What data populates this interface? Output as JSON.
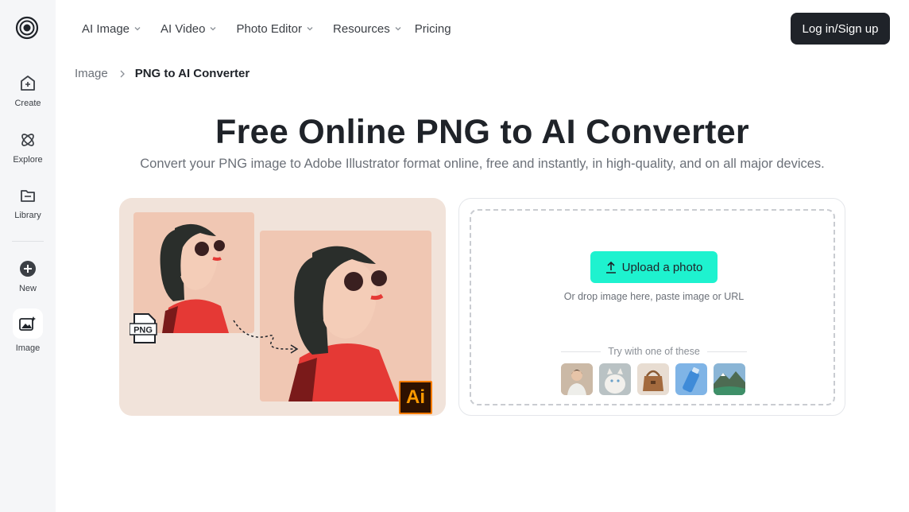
{
  "nav": {
    "items": [
      {
        "label": "AI Image"
      },
      {
        "label": "AI Video"
      },
      {
        "label": "Photo Editor"
      },
      {
        "label": "Resources"
      }
    ],
    "pricing": "Pricing",
    "login": "Log in/Sign up"
  },
  "sidebar": {
    "create": "Create",
    "explore": "Explore",
    "library": "Library",
    "new": "New",
    "image": "Image"
  },
  "breadcrumb": {
    "parent": "Image",
    "current": "PNG to AI Converter"
  },
  "hero": {
    "title": "Free Online PNG to AI Converter",
    "subtitle": "Convert your PNG image to Adobe Illustrator format online, free and instantly, in high-quality, and on all major devices."
  },
  "illustration": {
    "png_badge": "PNG",
    "ai_badge": "Ai"
  },
  "upload": {
    "button": "Upload a photo",
    "hint": "Or drop image here, paste image or URL",
    "try_label": "Try with one of these",
    "samples": [
      "sample-woman",
      "sample-cat",
      "sample-bag",
      "sample-bottle",
      "sample-landscape"
    ]
  },
  "colors": {
    "accent": "#1ef2cf",
    "dark": "#1f2329",
    "card_bg": "#f1e3da",
    "portrait_bg": "#f0c7b3",
    "ai_orange": "#ff9a00"
  }
}
